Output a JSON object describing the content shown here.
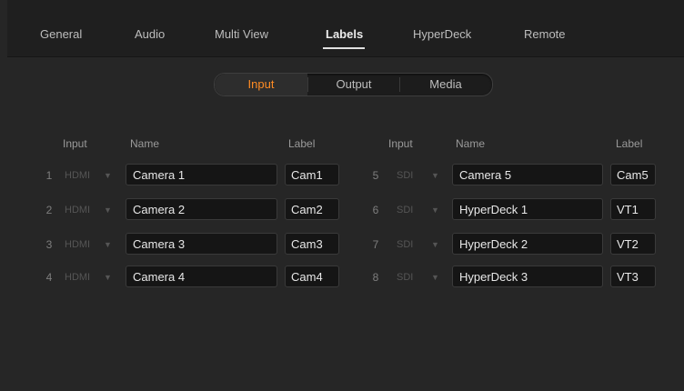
{
  "tabs": [
    {
      "label": "General"
    },
    {
      "label": "Audio"
    },
    {
      "label": "Multi View"
    },
    {
      "label": "Labels",
      "active": true
    },
    {
      "label": "HyperDeck"
    },
    {
      "label": "Remote"
    }
  ],
  "segments": [
    {
      "label": "Input",
      "active": true
    },
    {
      "label": "Output"
    },
    {
      "label": "Media"
    }
  ],
  "headers": {
    "left": {
      "input": "Input",
      "name": "Name",
      "label": "Label"
    },
    "right": {
      "input": "Input",
      "name": "Name",
      "label": "Label"
    }
  },
  "rows_left": [
    {
      "num": "1",
      "source": "HDMI",
      "name": "Camera 1",
      "label": "Cam1"
    },
    {
      "num": "2",
      "source": "HDMI",
      "name": "Camera 2",
      "label": "Cam2"
    },
    {
      "num": "3",
      "source": "HDMI",
      "name": "Camera 3",
      "label": "Cam3"
    },
    {
      "num": "4",
      "source": "HDMI",
      "name": "Camera 4",
      "label": "Cam4"
    }
  ],
  "rows_right": [
    {
      "num": "5",
      "source": "SDI",
      "name": "Camera 5",
      "label": "Cam5"
    },
    {
      "num": "6",
      "source": "SDI",
      "name": "HyperDeck 1",
      "label": "VT1"
    },
    {
      "num": "7",
      "source": "SDI",
      "name": "HyperDeck 2",
      "label": "VT2"
    },
    {
      "num": "8",
      "source": "SDI",
      "name": "HyperDeck 3",
      "label": "VT3"
    }
  ],
  "colors": {
    "accent": "#ff8c24",
    "background": "#262626",
    "field": "#151515"
  },
  "icons": {
    "dropdown": "chevron-down-icon"
  }
}
